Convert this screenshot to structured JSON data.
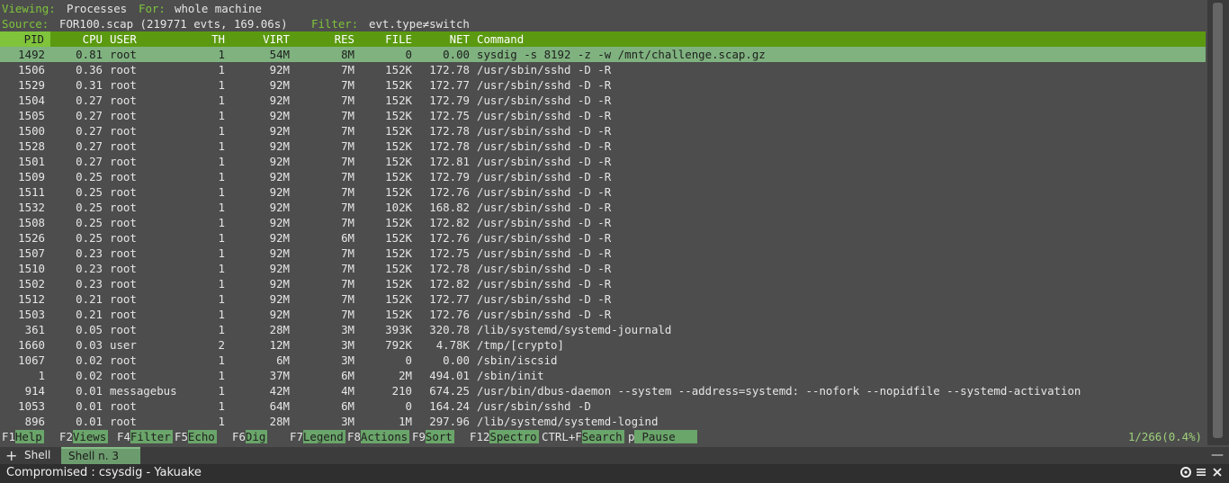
{
  "header": {
    "viewing_label": "Viewing:",
    "viewing_value": "Processes",
    "for_label": "For:",
    "for_value": "whole machine",
    "source_label": "Source:",
    "source_value": "FOR100.scap (219771 evts, 169.06s)",
    "filter_label": "Filter:",
    "filter_value": "evt.type≠switch"
  },
  "columns": [
    "PID",
    "CPU",
    "USER",
    "TH",
    "VIRT",
    "RES",
    "FILE",
    "NET",
    "Command"
  ],
  "rows": [
    {
      "pid": "1492",
      "cpu": "0.81",
      "user": "root",
      "th": "1",
      "virt": "54M",
      "res": "8M",
      "file": "0",
      "net": "0.00",
      "cmd": "sysdig -s 8192 -z -w /mnt/challenge.scap.gz"
    },
    {
      "pid": "1506",
      "cpu": "0.36",
      "user": "root",
      "th": "1",
      "virt": "92M",
      "res": "7M",
      "file": "152K",
      "net": "172.78",
      "cmd": "/usr/sbin/sshd -D -R"
    },
    {
      "pid": "1529",
      "cpu": "0.31",
      "user": "root",
      "th": "1",
      "virt": "92M",
      "res": "7M",
      "file": "152K",
      "net": "172.77",
      "cmd": "/usr/sbin/sshd -D -R"
    },
    {
      "pid": "1504",
      "cpu": "0.27",
      "user": "root",
      "th": "1",
      "virt": "92M",
      "res": "7M",
      "file": "152K",
      "net": "172.79",
      "cmd": "/usr/sbin/sshd -D -R"
    },
    {
      "pid": "1505",
      "cpu": "0.27",
      "user": "root",
      "th": "1",
      "virt": "92M",
      "res": "7M",
      "file": "152K",
      "net": "172.75",
      "cmd": "/usr/sbin/sshd -D -R"
    },
    {
      "pid": "1500",
      "cpu": "0.27",
      "user": "root",
      "th": "1",
      "virt": "92M",
      "res": "7M",
      "file": "152K",
      "net": "172.78",
      "cmd": "/usr/sbin/sshd -D -R"
    },
    {
      "pid": "1528",
      "cpu": "0.27",
      "user": "root",
      "th": "1",
      "virt": "92M",
      "res": "7M",
      "file": "152K",
      "net": "172.78",
      "cmd": "/usr/sbin/sshd -D -R"
    },
    {
      "pid": "1501",
      "cpu": "0.27",
      "user": "root",
      "th": "1",
      "virt": "92M",
      "res": "7M",
      "file": "152K",
      "net": "172.81",
      "cmd": "/usr/sbin/sshd -D -R"
    },
    {
      "pid": "1509",
      "cpu": "0.25",
      "user": "root",
      "th": "1",
      "virt": "92M",
      "res": "7M",
      "file": "152K",
      "net": "172.79",
      "cmd": "/usr/sbin/sshd -D -R"
    },
    {
      "pid": "1511",
      "cpu": "0.25",
      "user": "root",
      "th": "1",
      "virt": "92M",
      "res": "7M",
      "file": "152K",
      "net": "172.76",
      "cmd": "/usr/sbin/sshd -D -R"
    },
    {
      "pid": "1532",
      "cpu": "0.25",
      "user": "root",
      "th": "1",
      "virt": "92M",
      "res": "7M",
      "file": "102K",
      "net": "168.82",
      "cmd": "/usr/sbin/sshd -D -R"
    },
    {
      "pid": "1508",
      "cpu": "0.25",
      "user": "root",
      "th": "1",
      "virt": "92M",
      "res": "7M",
      "file": "152K",
      "net": "172.82",
      "cmd": "/usr/sbin/sshd -D -R"
    },
    {
      "pid": "1526",
      "cpu": "0.25",
      "user": "root",
      "th": "1",
      "virt": "92M",
      "res": "6M",
      "file": "152K",
      "net": "172.76",
      "cmd": "/usr/sbin/sshd -D -R"
    },
    {
      "pid": "1507",
      "cpu": "0.23",
      "user": "root",
      "th": "1",
      "virt": "92M",
      "res": "7M",
      "file": "152K",
      "net": "172.75",
      "cmd": "/usr/sbin/sshd -D -R"
    },
    {
      "pid": "1510",
      "cpu": "0.23",
      "user": "root",
      "th": "1",
      "virt": "92M",
      "res": "7M",
      "file": "152K",
      "net": "172.78",
      "cmd": "/usr/sbin/sshd -D -R"
    },
    {
      "pid": "1502",
      "cpu": "0.23",
      "user": "root",
      "th": "1",
      "virt": "92M",
      "res": "7M",
      "file": "152K",
      "net": "172.82",
      "cmd": "/usr/sbin/sshd -D -R"
    },
    {
      "pid": "1512",
      "cpu": "0.21",
      "user": "root",
      "th": "1",
      "virt": "92M",
      "res": "7M",
      "file": "152K",
      "net": "172.77",
      "cmd": "/usr/sbin/sshd -D -R"
    },
    {
      "pid": "1503",
      "cpu": "0.21",
      "user": "root",
      "th": "1",
      "virt": "92M",
      "res": "7M",
      "file": "152K",
      "net": "172.76",
      "cmd": "/usr/sbin/sshd -D -R"
    },
    {
      "pid": "361",
      "cpu": "0.05",
      "user": "root",
      "th": "1",
      "virt": "28M",
      "res": "3M",
      "file": "393K",
      "net": "320.78",
      "cmd": "/lib/systemd/systemd-journald"
    },
    {
      "pid": "1660",
      "cpu": "0.03",
      "user": "user",
      "th": "2",
      "virt": "12M",
      "res": "3M",
      "file": "792K",
      "net": "4.78K",
      "cmd": "/tmp/[crypto]"
    },
    {
      "pid": "1067",
      "cpu": "0.02",
      "user": "root",
      "th": "1",
      "virt": "6M",
      "res": "3M",
      "file": "0",
      "net": "0.00",
      "cmd": "/sbin/iscsid"
    },
    {
      "pid": "1",
      "cpu": "0.02",
      "user": "root",
      "th": "1",
      "virt": "37M",
      "res": "6M",
      "file": "2M",
      "net": "494.01",
      "cmd": "/sbin/init"
    },
    {
      "pid": "914",
      "cpu": "0.01",
      "user": "messagebus",
      "th": "1",
      "virt": "42M",
      "res": "4M",
      "file": "210",
      "net": "674.25",
      "cmd": "/usr/bin/dbus-daemon --system --address=systemd: --nofork --nopidfile --systemd-activation"
    },
    {
      "pid": "1053",
      "cpu": "0.01",
      "user": "root",
      "th": "1",
      "virt": "64M",
      "res": "6M",
      "file": "0",
      "net": "164.24",
      "cmd": "/usr/sbin/sshd -D"
    },
    {
      "pid": "896",
      "cpu": "0.01",
      "user": "root",
      "th": "1",
      "virt": "28M",
      "res": "3M",
      "file": "1M",
      "net": "297.96",
      "cmd": "/lib/systemd/systemd-logind"
    }
  ],
  "fkeys": [
    {
      "key": "F1",
      "action": "Help"
    },
    {
      "key": "F2",
      "action": "Views"
    },
    {
      "key": "F4",
      "action": "Filter"
    },
    {
      "key": "F5",
      "action": "Echo"
    },
    {
      "key": "F6",
      "action": "Dig"
    },
    {
      "key": "F7",
      "action": "Legend"
    },
    {
      "key": "F8",
      "action": "Actions"
    },
    {
      "key": "F9",
      "action": "Sort"
    },
    {
      "key": "F12",
      "action": "Spectro"
    },
    {
      "key": "CTRL+F",
      "action": "Search"
    },
    {
      "key": "p",
      "action": "Pause"
    }
  ],
  "progress": "1/266(0.4%)",
  "tabs": {
    "add_icon": "+",
    "items": [
      "Shell",
      "Shell n. 3"
    ],
    "close_icon": "—"
  },
  "window": {
    "title": "Compromised : csysdig - Yakuake"
  },
  "icons": {
    "add": "plus-icon",
    "settings": "gear-icon",
    "menu": "hamburger-icon",
    "close": "close-icon"
  }
}
